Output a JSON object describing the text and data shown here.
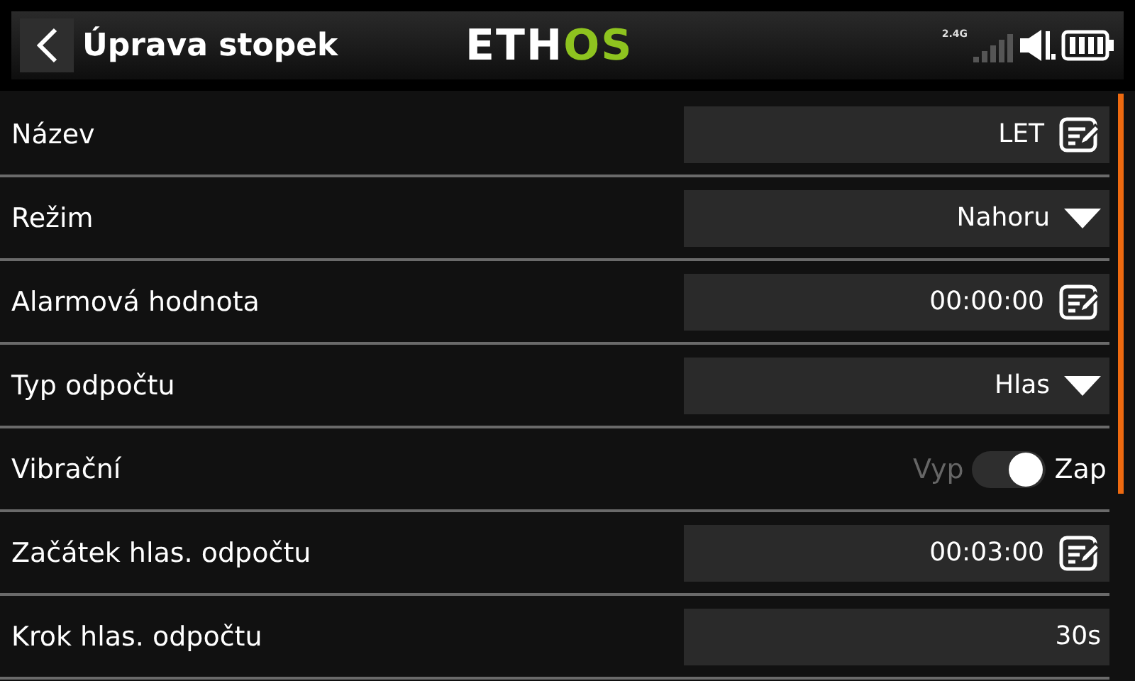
{
  "header": {
    "title": "Úprava stopek",
    "logo": {
      "main": "ETH",
      "accent": "OS"
    },
    "radio_band": "2.4G"
  },
  "rows": [
    {
      "label": "Název",
      "kind": "text",
      "value": "LET"
    },
    {
      "label": "Režim",
      "kind": "choice",
      "value": "Nahoru"
    },
    {
      "label": "Alarmová hodnota",
      "kind": "text",
      "value": "00:00:00"
    },
    {
      "label": "Typ odpočtu",
      "kind": "choice",
      "value": "Hlas"
    },
    {
      "label": "Vibrační",
      "kind": "toggle",
      "off_label": "Vyp",
      "on_label": "Zap",
      "on": true
    },
    {
      "label": "Začátek hlas. odpočtu",
      "kind": "text",
      "value": "00:03:00"
    },
    {
      "label": "Krok hlas. odpočtu",
      "kind": "value",
      "value": "30s"
    }
  ]
}
